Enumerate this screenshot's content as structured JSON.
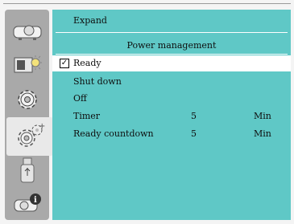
{
  "sidebar": {
    "items": [
      {
        "icon": "projector-icon"
      },
      {
        "icon": "picture-adjust-icon"
      },
      {
        "icon": "gear-icon"
      },
      {
        "icon": "expand-settings-icon",
        "selected": true
      },
      {
        "icon": "usb-memory-icon"
      },
      {
        "icon": "info-icon"
      }
    ]
  },
  "header": {
    "title": "Expand"
  },
  "section": {
    "title": "Power management"
  },
  "options": [
    {
      "label": "Ready",
      "checked": true,
      "value": "",
      "unit": ""
    },
    {
      "label": "Shut down",
      "checked": false,
      "value": "",
      "unit": ""
    },
    {
      "label": "Off",
      "checked": false,
      "value": "",
      "unit": ""
    },
    {
      "label": "Timer",
      "checked": false,
      "value": "5",
      "unit": "Min"
    },
    {
      "label": "Ready countdown",
      "checked": false,
      "value": "5",
      "unit": "Min"
    }
  ],
  "colors": {
    "panel": "#5fc8c6",
    "sidebar": "#a9a9a9",
    "selected_row": "#ffffff"
  }
}
